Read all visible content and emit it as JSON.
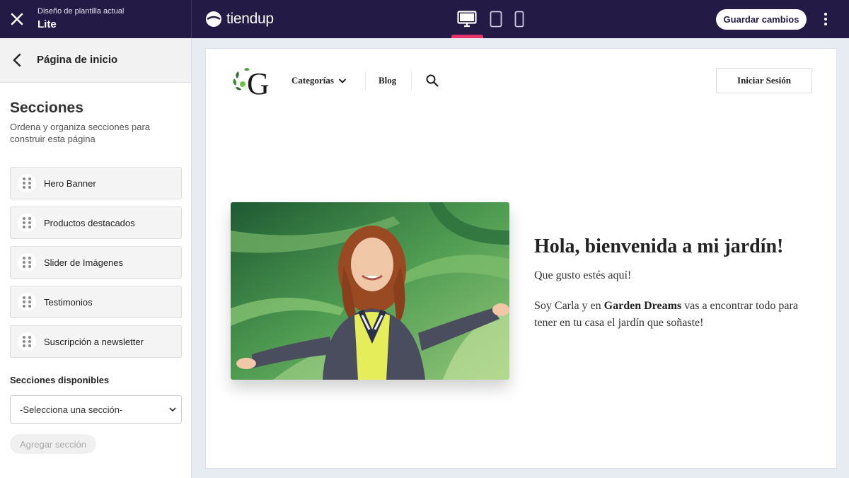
{
  "topbar": {
    "template_caption": "Diseño de plantilla actual",
    "template_name": "Lite",
    "brand": "tiendup",
    "save_label": "Guardar cambios",
    "active_device": "desktop",
    "accent_color": "#e8336b",
    "background_color": "#231a45"
  },
  "sidebar": {
    "page_title": "Página de inicio",
    "sections_title": "Secciones",
    "sections_description": "Ordena y organiza secciones para construir esta página",
    "items": [
      {
        "label": "Hero Banner"
      },
      {
        "label": "Productos destacados"
      },
      {
        "label": "Slider de Imágenes"
      },
      {
        "label": "Testimonios"
      },
      {
        "label": "Suscripción a newsletter"
      }
    ],
    "available_title": "Secciones disponibles",
    "select_value": "-Selecciona una sección-",
    "add_label": "Agregar sección"
  },
  "preview": {
    "nav": {
      "categories": "Categorías",
      "blog": "Blog",
      "login": "Iniciar Sesión"
    },
    "hero": {
      "title": "Hola, bienvenida a mi jardín!",
      "subtitle": "Que gusto estés aquí!",
      "body_prefix": "Soy Carla y en ",
      "body_bold": "Garden Dreams",
      "body_suffix": " vas a encontrar todo para tener en tu casa el jardín que soñaste!"
    }
  }
}
